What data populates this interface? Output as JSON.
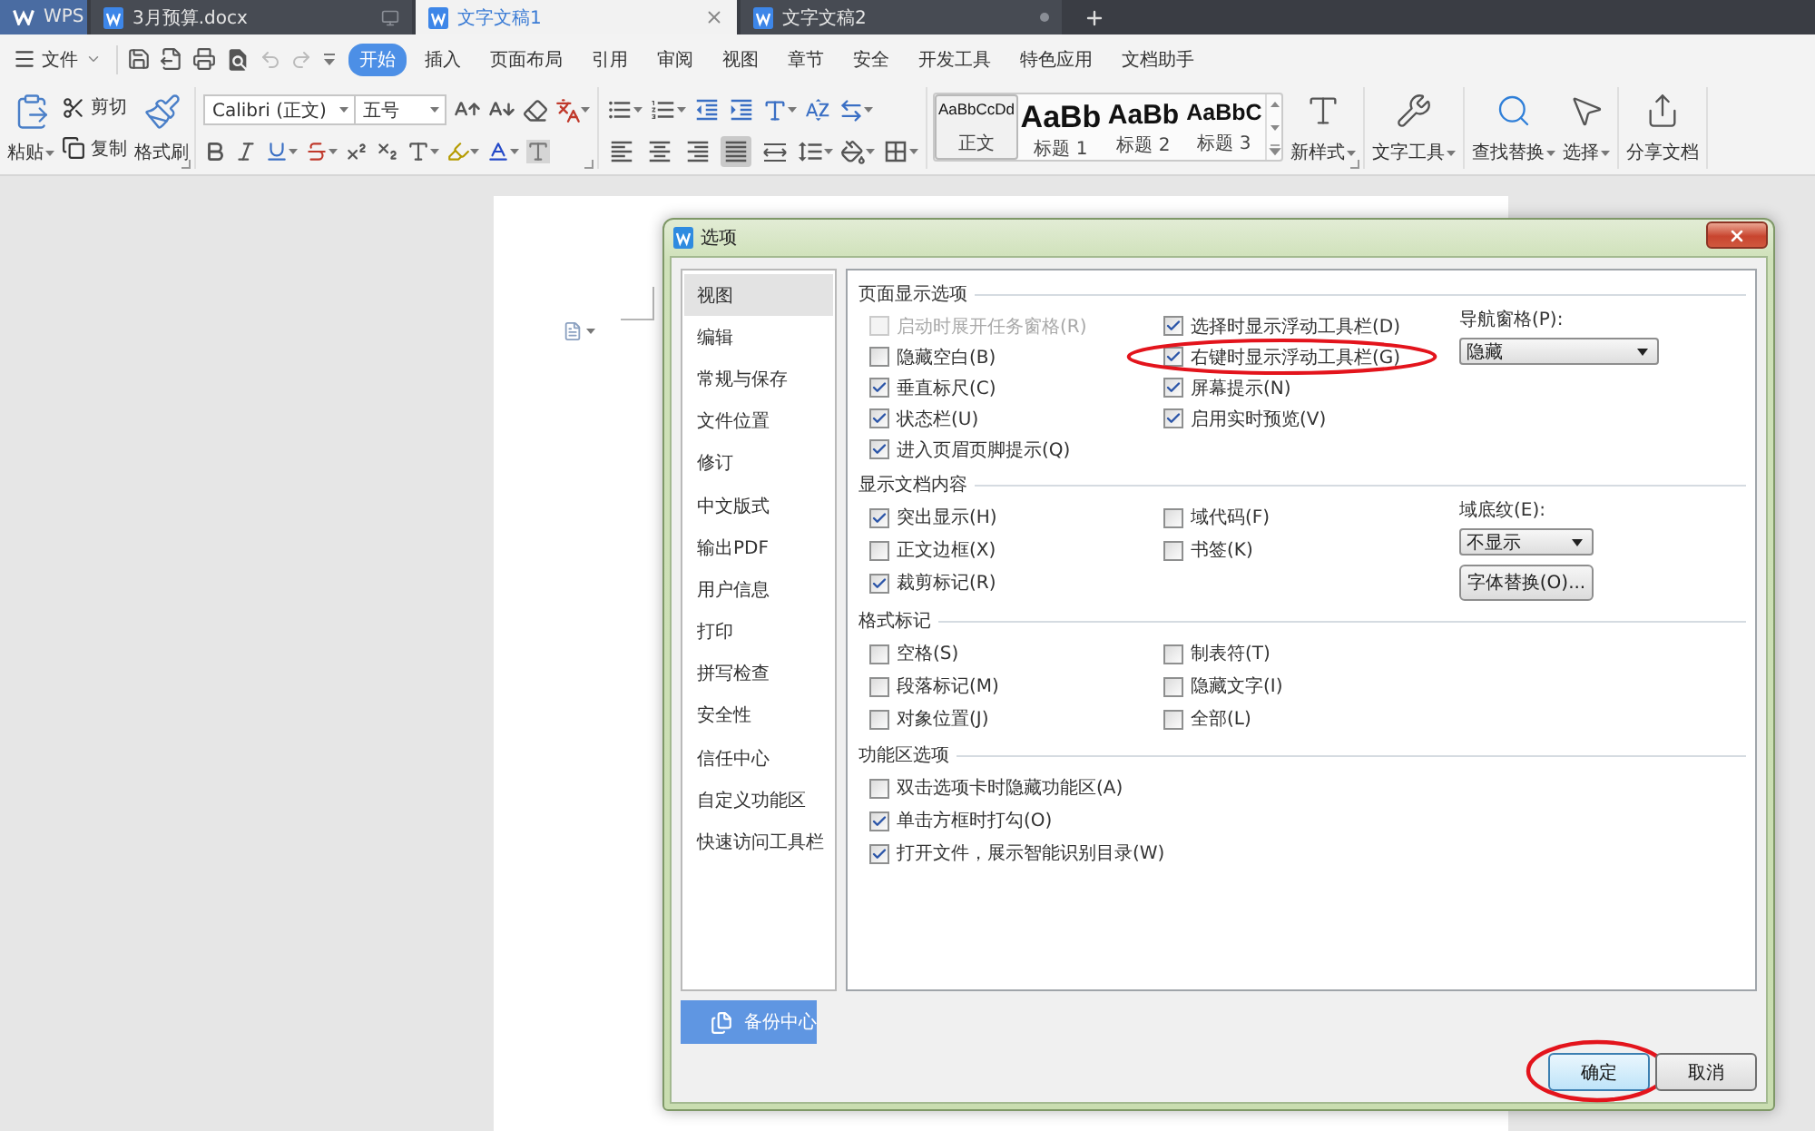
{
  "tabs": [
    {
      "kind": "home",
      "label": "WPS",
      "selected": false
    },
    {
      "kind": "document",
      "label": "3月预算.docx",
      "selected": false
    },
    {
      "kind": "document",
      "label": "文字文稿1",
      "selected": true
    },
    {
      "kind": "document",
      "label": "文字文稿2",
      "selected": false
    }
  ],
  "menu": {
    "file": "文件",
    "items": [
      {
        "label": "开始",
        "selected": true
      },
      {
        "label": "插入",
        "selected": false
      },
      {
        "label": "页面布局",
        "selected": false
      },
      {
        "label": "引用",
        "selected": false
      },
      {
        "label": "审阅",
        "selected": false
      },
      {
        "label": "视图",
        "selected": false
      },
      {
        "label": "章节",
        "selected": false
      },
      {
        "label": "安全",
        "selected": false
      },
      {
        "label": "开发工具",
        "selected": false
      },
      {
        "label": "特色应用",
        "selected": false
      },
      {
        "label": "文档助手",
        "selected": false
      }
    ]
  },
  "ribbon": {
    "clipboard": {
      "paste": "粘贴",
      "cut": "剪切",
      "copy": "复制",
      "format_painter": "格式刷"
    },
    "font": {
      "family": "Calibri (正文)",
      "size": "五号"
    },
    "alignment": [
      {
        "kind": "left",
        "selected": false
      },
      {
        "kind": "center",
        "selected": false
      },
      {
        "kind": "right",
        "selected": false
      },
      {
        "kind": "justify",
        "selected": true
      },
      {
        "kind": "distributed",
        "selected": false
      }
    ],
    "styles": [
      {
        "preview": "AaBbCcDd",
        "label": "正文",
        "selected": true
      },
      {
        "preview": "AaBb",
        "label": "标题 1",
        "selected": false
      },
      {
        "preview": "AaBb",
        "label": "标题 2",
        "selected": false
      },
      {
        "preview": "AaBbC",
        "label": "标题 3",
        "selected": false
      }
    ],
    "tools": [
      {
        "kind": "new_style",
        "label": "新样式"
      },
      {
        "kind": "text_tools",
        "label": "文字工具"
      },
      {
        "kind": "find_replace",
        "label": "查找替换"
      },
      {
        "kind": "select",
        "label": "选择"
      },
      {
        "kind": "share",
        "label": "分享文档"
      }
    ]
  },
  "dialog": {
    "title": "选项",
    "nav": [
      {
        "label": "视图",
        "selected": true
      },
      {
        "label": "编辑",
        "selected": false
      },
      {
        "label": "常规与保存",
        "selected": false
      },
      {
        "label": "文件位置",
        "selected": false
      },
      {
        "label": "修订",
        "selected": false
      },
      {
        "label": "中文版式",
        "selected": false
      },
      {
        "label": "输出PDF",
        "selected": false
      },
      {
        "label": "用户信息",
        "selected": false
      },
      {
        "label": "打印",
        "selected": false
      },
      {
        "label": "拼写检查",
        "selected": false
      },
      {
        "label": "安全性",
        "selected": false
      },
      {
        "label": "信任中心",
        "selected": false
      },
      {
        "label": "自定义功能区",
        "selected": false
      },
      {
        "label": "快速访问工具栏",
        "selected": false
      }
    ],
    "backup": "备份中心",
    "sections": [
      {
        "title": "页面显示选项",
        "columns": [
          [
            {
              "label": "启动时展开任务窗格(R)",
              "checked": false,
              "disabled": true,
              "circled": false
            },
            {
              "label": "隐藏空白(B)",
              "checked": false,
              "disabled": false,
              "circled": false
            },
            {
              "label": "垂直标尺(C)",
              "checked": true,
              "disabled": false,
              "circled": false
            },
            {
              "label": "状态栏(U)",
              "checked": true,
              "disabled": false,
              "circled": false
            },
            {
              "label": "进入页眉页脚提示(Q)",
              "checked": true,
              "disabled": false,
              "circled": false
            }
          ],
          [
            {
              "label": "选择时显示浮动工具栏(D)",
              "checked": true,
              "disabled": false,
              "circled": false
            },
            {
              "label": "右键时显示浮动工具栏(G)",
              "checked": true,
              "disabled": false,
              "circled": true
            },
            {
              "label": "屏幕提示(N)",
              "checked": true,
              "disabled": false,
              "circled": false
            },
            {
              "label": "启用实时预览(V)",
              "checked": true,
              "disabled": false,
              "circled": false
            }
          ]
        ],
        "side": [
          {
            "kind": "select",
            "label": "导航窗格(P):",
            "value": "隐藏"
          }
        ]
      },
      {
        "title": "显示文档内容",
        "columns": [
          [
            {
              "label": "突出显示(H)",
              "checked": true,
              "disabled": false,
              "circled": false
            },
            {
              "label": "正文边框(X)",
              "checked": false,
              "disabled": false,
              "circled": false
            },
            {
              "label": "裁剪标记(R)",
              "checked": true,
              "disabled": false,
              "circled": false
            }
          ],
          [
            {
              "label": "域代码(F)",
              "checked": false,
              "disabled": false,
              "circled": false
            },
            {
              "label": "书签(K)",
              "checked": false,
              "disabled": false,
              "circled": false
            }
          ]
        ],
        "side": [
          {
            "kind": "select",
            "label": "域底纹(E):",
            "value": "不显示"
          },
          {
            "kind": "button",
            "label": "字体替换(O)..."
          }
        ]
      },
      {
        "title": "格式标记",
        "columns": [
          [
            {
              "label": "空格(S)",
              "checked": false,
              "disabled": false,
              "circled": false
            },
            {
              "label": "段落标记(M)",
              "checked": false,
              "disabled": false,
              "circled": false
            },
            {
              "label": "对象位置(J)",
              "checked": false,
              "disabled": false,
              "circled": false
            }
          ],
          [
            {
              "label": "制表符(T)",
              "checked": false,
              "disabled": false,
              "circled": false
            },
            {
              "label": "隐藏文字(I)",
              "checked": false,
              "disabled": false,
              "circled": false
            },
            {
              "label": "全部(L)",
              "checked": false,
              "disabled": false,
              "circled": false
            }
          ]
        ]
      },
      {
        "title": "功能区选项",
        "columns": [
          [
            {
              "label": "双击选项卡时隐藏功能区(A)",
              "checked": false,
              "disabled": false,
              "circled": false
            },
            {
              "label": "单击方框时打勾(O)",
              "checked": true,
              "disabled": false,
              "circled": false
            },
            {
              "label": "打开文件，展示智能识别目录(W)",
              "checked": true,
              "disabled": false,
              "circled": false
            }
          ]
        ]
      }
    ],
    "buttons": [
      {
        "kind": "primary",
        "label": "确定",
        "circled": true
      },
      {
        "kind": "normal",
        "label": "取消",
        "circled": false
      }
    ]
  }
}
